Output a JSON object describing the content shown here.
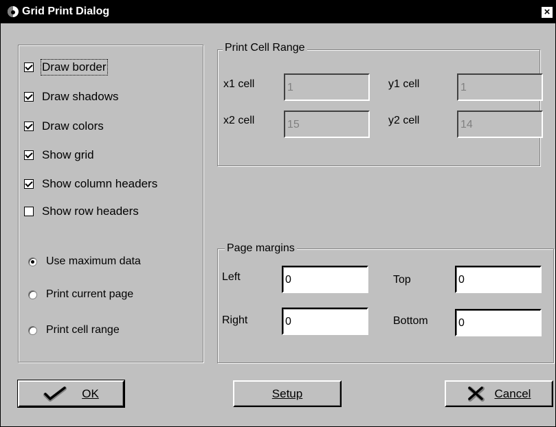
{
  "window": {
    "title": "Grid Print Dialog",
    "close_label": "×"
  },
  "options": [
    {
      "label": "Draw border",
      "checked": true
    },
    {
      "label": "Draw shadows",
      "checked": true
    },
    {
      "label": "Draw colors",
      "checked": true
    },
    {
      "label": "Show grid",
      "checked": true
    },
    {
      "label": "Show column headers",
      "checked": true
    },
    {
      "label": "Show row headers",
      "checked": false
    }
  ],
  "print_mode": {
    "selected": "Use maximum data",
    "options": [
      "Use maximum data",
      "Print current page",
      "Print cell range"
    ]
  },
  "cell_range": {
    "legend": "Print Cell Range",
    "x1_label": "x1 cell",
    "x1_value": "1",
    "y1_label": "y1 cell",
    "y1_value": "1",
    "x2_label": "x2 cell",
    "x2_value": "15",
    "y2_label": "y2 cell",
    "y2_value": "14"
  },
  "margins": {
    "legend": "Page margins",
    "left_label": "Left",
    "left_value": "0",
    "top_label": "Top",
    "top_value": "0",
    "right_label": "Right",
    "right_value": "0",
    "bottom_label": "Bottom",
    "bottom_value": "0"
  },
  "buttons": {
    "ok_label": "OK",
    "setup_label": "Setup",
    "cancel_label": "Cancel"
  }
}
